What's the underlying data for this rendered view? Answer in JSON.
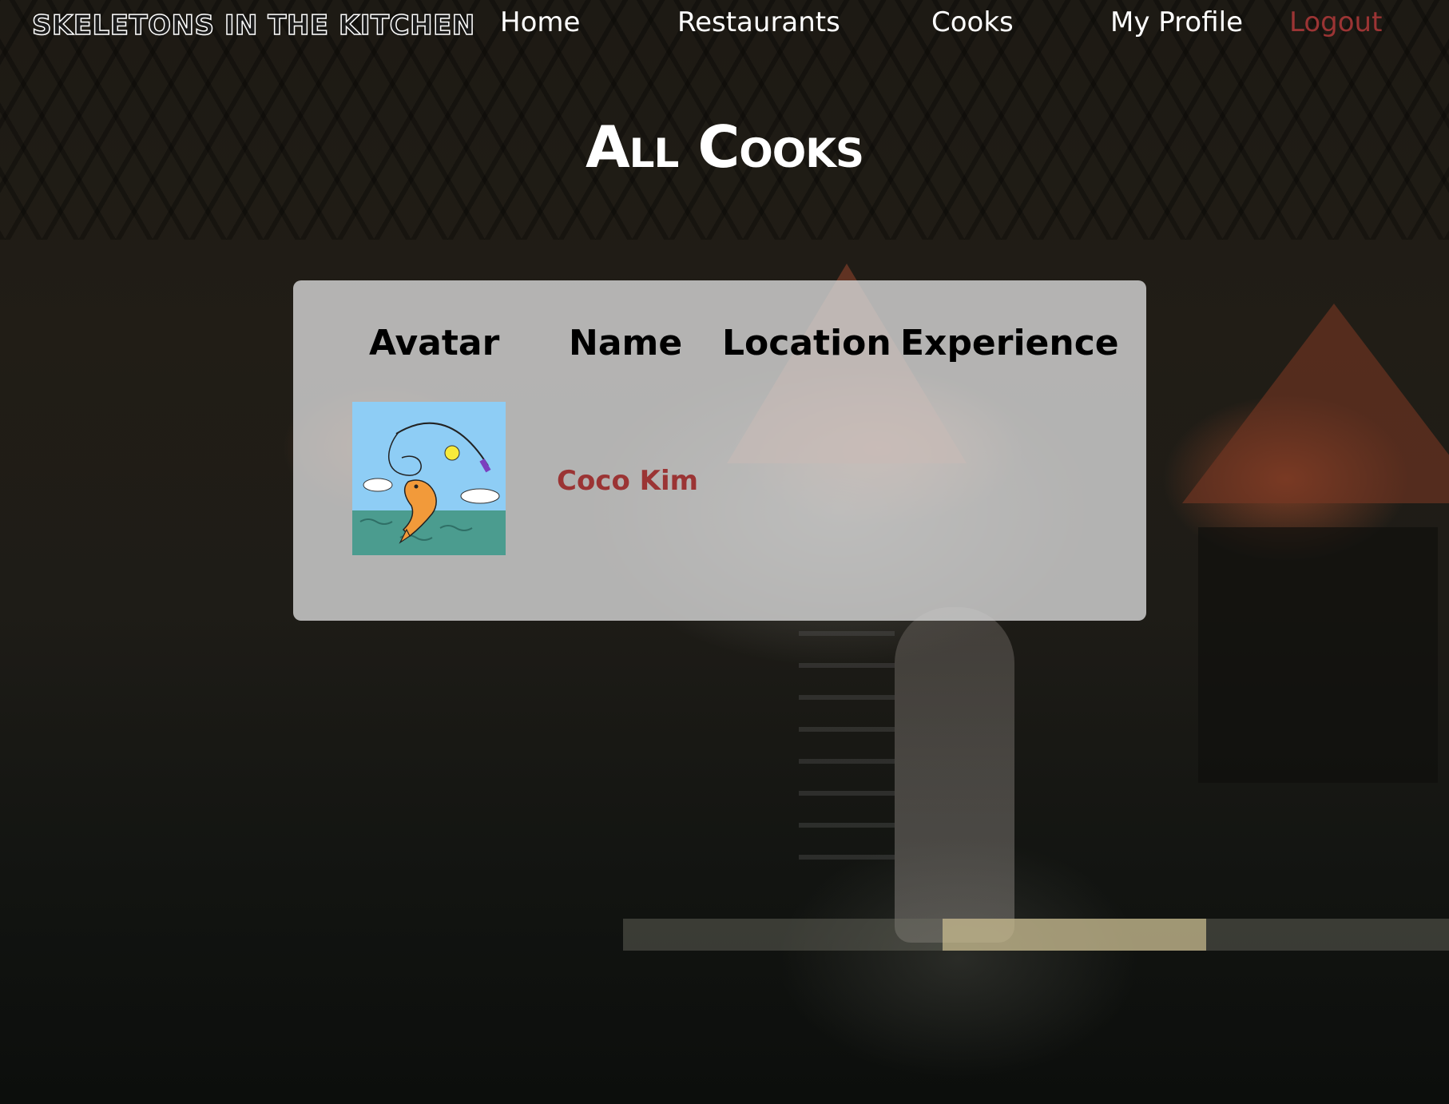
{
  "nav": {
    "logo": "Skeletons in the Kitchen",
    "links": [
      {
        "label": "Home"
      },
      {
        "label": "Restaurants"
      },
      {
        "label": "Cooks"
      },
      {
        "label": "My Profile"
      },
      {
        "label": "Logout"
      }
    ]
  },
  "page": {
    "title": "All Cooks"
  },
  "table": {
    "headers": [
      "Avatar",
      "Name",
      "Location",
      "Experience"
    ],
    "rows": [
      {
        "avatar_icon": "fish-jumping-avatar",
        "name": "Coco Kim",
        "location": "",
        "experience": ""
      }
    ]
  },
  "colors": {
    "accent": "#9b3434",
    "card": "#d4d4d4",
    "text_light": "#ffffff"
  }
}
